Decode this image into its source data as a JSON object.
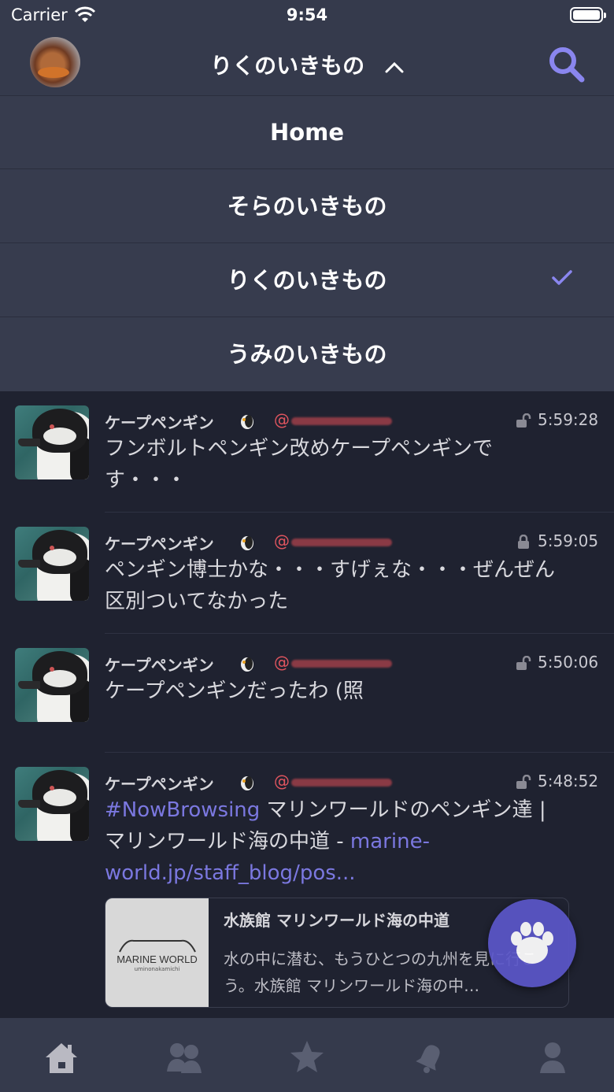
{
  "status_bar": {
    "carrier": "Carrier",
    "time": "9:54"
  },
  "nav": {
    "title": "りくのいきもの"
  },
  "dropdown": {
    "items": [
      {
        "label": "Home",
        "selected": false
      },
      {
        "label": "そらのいきもの",
        "selected": false
      },
      {
        "label": "りくのいきもの",
        "selected": true
      },
      {
        "label": "うみのいきもの",
        "selected": false
      }
    ]
  },
  "timeline": [
    {
      "name": "ケープペンギン",
      "handle": "@",
      "time": "5:59:28",
      "lock": "open",
      "text": "フンボルトペンギン改めケープペンギンです・・・"
    },
    {
      "name": "ケープペンギン",
      "handle": "@",
      "time": "5:59:05",
      "lock": "closed",
      "text": "ペンギン博士かな・・・すげぇな・・・ぜんぜん区別ついてなかった"
    },
    {
      "name": "ケープペンギン",
      "handle": "@",
      "time": "5:50:06",
      "lock": "open",
      "text": "ケープペンギンだったわ (照"
    },
    {
      "name": "ケープペンギン",
      "handle": "@",
      "time": "5:48:52",
      "lock": "open",
      "text_hashtag": "#NowBrowsing",
      "text_body": " マリンワールドのペンギン達 | マリンワールド海の中道 - ",
      "text_link": "marine-world.jp/staff_blog/pos...",
      "card": {
        "title": "水族館 マリンワールド海の中道",
        "description": "水の中に潜む、もうひとつの九州を見に行こう。水族館 マリンワールド海の中…",
        "brand": "MARINE WORLD",
        "brand_sub": "uminonakamichi"
      }
    }
  ],
  "tab_bar": {
    "icons": [
      "home-icon",
      "people-icon",
      "star-icon",
      "bell-icon",
      "person-icon"
    ]
  },
  "colors": {
    "accent": "#7b78e0",
    "fab": "#5b56c8",
    "bar": "#353a4c",
    "background": "#1f2230"
  }
}
